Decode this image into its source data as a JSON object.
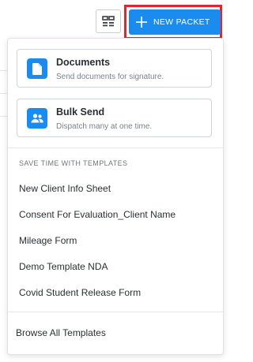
{
  "toolbar": {
    "new_packet_label": "NEW PACKET"
  },
  "menu": {
    "options": [
      {
        "title": "Documents",
        "description": "Send documents for signature.",
        "icon": "document-icon"
      },
      {
        "title": "Bulk Send",
        "description": "Dispatch many at one time.",
        "icon": "group-icon"
      }
    ],
    "templates_header": "SAVE TIME WITH TEMPLATES",
    "templates": [
      "New Client Info Sheet",
      "Consent For Evaluation_Client Name",
      "Mileage Form",
      "Demo Template NDA",
      "Covid Student Release Form"
    ],
    "browse_all_label": "Browse All Templates"
  },
  "colors": {
    "accent": "#1a8cf0",
    "highlight_box": "#e3262b"
  }
}
